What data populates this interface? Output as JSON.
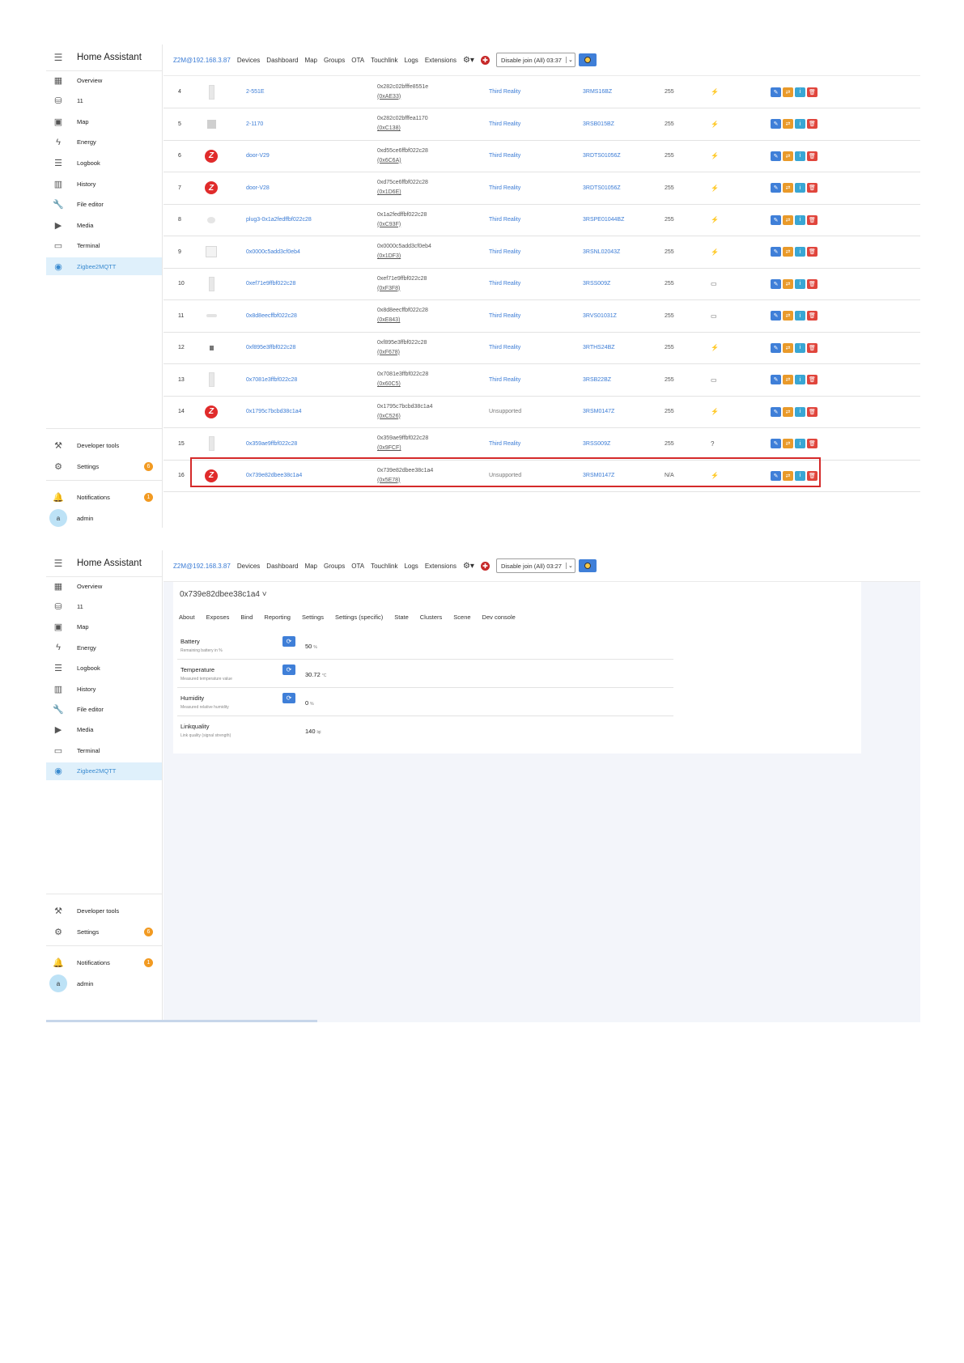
{
  "sidebar": {
    "title": "Home Assistant",
    "items": [
      {
        "label": "Overview",
        "icon": "overview-icon",
        "glyph": "▦"
      },
      {
        "label": "11",
        "icon": "database-icon",
        "glyph": "⛁"
      },
      {
        "label": "Map",
        "icon": "map-icon",
        "glyph": "▣"
      },
      {
        "label": "Energy",
        "icon": "lightning-icon",
        "glyph": "ϟ"
      },
      {
        "label": "Logbook",
        "icon": "list-icon",
        "glyph": "☰"
      },
      {
        "label": "History",
        "icon": "chart-icon",
        "glyph": "▥"
      },
      {
        "label": "File editor",
        "icon": "wrench-icon",
        "glyph": "🔧"
      },
      {
        "label": "Media",
        "icon": "media-icon",
        "glyph": "▶"
      },
      {
        "label": "Terminal",
        "icon": "terminal-icon",
        "glyph": "▭"
      },
      {
        "label": "Zigbee2MQTT",
        "icon": "zigbee-icon",
        "glyph": "◉"
      }
    ],
    "developer_tools": "Developer tools",
    "settings": "Settings",
    "settings_badge": "6",
    "notifications": "Notifications",
    "notifications_badge": "1",
    "user": "admin",
    "avatar_letter": "a"
  },
  "topbar1": {
    "brand": "Z2M@192.168.3.87",
    "nav": [
      "Devices",
      "Dashboard",
      "Map",
      "Groups",
      "OTA",
      "Touchlink",
      "Logs",
      "Extensions"
    ],
    "join_label": "Disable join (All) 03:37"
  },
  "topbar2": {
    "brand": "Z2M@192.168.3.87",
    "nav": [
      "Devices",
      "Dashboard",
      "Map",
      "Groups",
      "OTA",
      "Touchlink",
      "Logs",
      "Extensions"
    ],
    "join_label": "Disable join (All) 03:27"
  },
  "devices": [
    {
      "num": "4",
      "name": "2-551E",
      "ieee": "0x282c02bfffe8551e",
      "nwk": "(0xAE33)",
      "vendor": "Third Reality",
      "model": "3RMS16BZ",
      "lqi": "255",
      "power": "⚡",
      "img": "tall"
    },
    {
      "num": "5",
      "name": "2-1170",
      "ieee": "0x282c02bfffea1170",
      "nwk": "(0xC138)",
      "vendor": "Third Reality",
      "model": "3RSB015BZ",
      "lqi": "255",
      "power": "⚡",
      "img": "sq"
    },
    {
      "num": "6",
      "name": "door-V29",
      "ieee": "0xd55ce6ffbf022c28",
      "nwk": "(0x6C6A)",
      "vendor": "Third Reality",
      "model": "3RDTS01056Z",
      "lqi": "255",
      "power": "⚡",
      "img": "zigbee"
    },
    {
      "num": "7",
      "name": "door-V28",
      "ieee": "0xd75ce6ffbf022c28",
      "nwk": "(0x1D6E)",
      "vendor": "Third Reality",
      "model": "3RDTS01056Z",
      "lqi": "255",
      "power": "⚡",
      "img": "zigbee"
    },
    {
      "num": "8",
      "name": "plug3-0x1a2fedffbf022c28",
      "ieee": "0x1a2fedffbf022c28",
      "nwk": "(0xC93F)",
      "vendor": "Third Reality",
      "model": "3RSPE01044BZ",
      "lqi": "255",
      "power": "⚡",
      "img": "plug"
    },
    {
      "num": "9",
      "name": "0x0000c5add3cf0eb4",
      "ieee": "0x0000c5add3cf0eb4",
      "nwk": "(0x1DF3)",
      "vendor": "Third Reality",
      "model": "3RSNL02043Z",
      "lqi": "255",
      "power": "⚡",
      "img": "sensor"
    },
    {
      "num": "10",
      "name": "0xef71e9ffbf022c28",
      "ieee": "0xef71e9ffbf022c28",
      "nwk": "(0xF3F8)",
      "vendor": "Third Reality",
      "model": "3RSS009Z",
      "lqi": "255",
      "power": "▭",
      "img": "tall"
    },
    {
      "num": "11",
      "name": "0x8d8eecffbf022c28",
      "ieee": "0x8d8eecffbf022c28",
      "nwk": "(0xE843)",
      "vendor": "Third Reality",
      "model": "3RVS01031Z",
      "lqi": "255",
      "power": "▭",
      "img": "flat"
    },
    {
      "num": "12",
      "name": "0xf895e3ffbf022c28",
      "ieee": "0xf895e3ffbf022c28",
      "nwk": "(0xF678)",
      "vendor": "Third Reality",
      "model": "3RTHS24BZ",
      "lqi": "255",
      "power": "⚡",
      "img": "mini"
    },
    {
      "num": "13",
      "name": "0x7081e3ffbf022c28",
      "ieee": "0x7081e3ffbf022c28",
      "nwk": "(0x60C5)",
      "vendor": "Third Reality",
      "model": "3RSB22BZ",
      "lqi": "255",
      "power": "▭",
      "img": "tall"
    },
    {
      "num": "14",
      "name": "0x1795c7bcbd38c1a4",
      "ieee": "0x1795c7bcbd38c1a4",
      "nwk": "(0xC526)",
      "vendor": "Unsupported",
      "model": "3RSM0147Z",
      "lqi": "255",
      "power": "⚡",
      "img": "zigbee"
    },
    {
      "num": "15",
      "name": "0x359ae9ffbf022c28",
      "ieee": "0x359ae9ffbf022c28",
      "nwk": "(0x9FCF)",
      "vendor": "Third Reality",
      "model": "3RSS009Z",
      "lqi": "255",
      "power": "?",
      "img": "tall"
    },
    {
      "num": "16",
      "name": "0x739e82dbee38c1a4",
      "ieee": "0x739e82dbee38c1a4",
      "nwk": "(0x5E78)",
      "vendor": "Unsupported",
      "model": "3RSM0147Z",
      "lqi": "N/A",
      "power": "⚡",
      "img": "zigbee"
    }
  ],
  "detail": {
    "device_title": "0x739e82dbee38c1a4 ˅",
    "tabs": [
      "About",
      "Exposes",
      "Bind",
      "Reporting",
      "Settings",
      "Settings (specific)",
      "State",
      "Clusters",
      "Scene",
      "Dev console"
    ],
    "exposes": [
      {
        "name": "Battery",
        "desc": "Remaining battery in %",
        "value": "50",
        "unit": "%",
        "refresh": true
      },
      {
        "name": "Temperature",
        "desc": "Measured temperature value",
        "value": "30.72",
        "unit": "°C",
        "refresh": true
      },
      {
        "name": "Humidity",
        "desc": "Measured relative humidity",
        "value": "0",
        "unit": "%",
        "refresh": true
      },
      {
        "name": "Linkquality",
        "desc": "Link quality (signal strength)",
        "value": "140",
        "unit": "lqi",
        "refresh": false
      }
    ]
  },
  "colors": {
    "accent": "#3f7fd8",
    "highlight": "#d42a2a",
    "zigbee": "#e02b2b"
  }
}
